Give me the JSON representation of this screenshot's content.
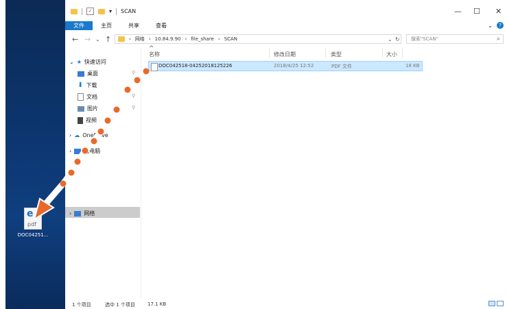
{
  "window": {
    "title": "SCAN",
    "ribbon_tabs": [
      "文件",
      "主页",
      "共享",
      "查看"
    ],
    "controls": {
      "minimize": "—",
      "maximize": "☐",
      "close": "✕"
    }
  },
  "address": {
    "crumbs": [
      "网络",
      "10.84.9.90",
      "file_share",
      "SCAN"
    ],
    "search_placeholder": "搜索\"SCAN\""
  },
  "nav": {
    "quick_access": "快速访问",
    "items": [
      "桌面",
      "下载",
      "文档",
      "图片",
      "视频"
    ],
    "onedrive": "OneDrive",
    "thispc": "此电脑",
    "network": "网络"
  },
  "columns": {
    "name": "名称",
    "date": "修改日期",
    "type": "类型",
    "size": "大小"
  },
  "files": [
    {
      "name": "DOC042518-04252018125226",
      "date": "2018/4/25 12:52",
      "type": "PDF 文件",
      "size": "18 KB"
    }
  ],
  "status": {
    "count": "1 个项目",
    "selected": "选中 1 个项目",
    "size": "17.1 KB"
  },
  "desktop": {
    "icon_label": "DOC04251...",
    "icon_text": "pdf"
  },
  "colors": {
    "accent": "#1979ca",
    "selection": "#cce8ff",
    "drag_dots": "#e8692c"
  }
}
